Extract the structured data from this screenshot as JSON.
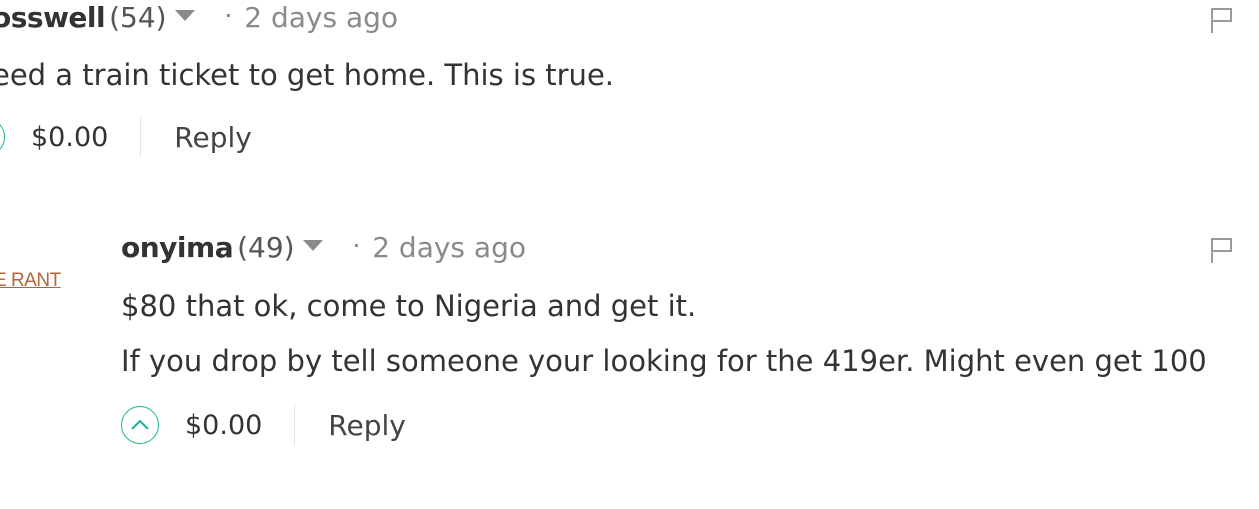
{
  "comments": [
    {
      "username": "osswell",
      "reputation": "(54)",
      "separator": "·",
      "timestamp": "2 days ago",
      "body": [
        "eed a train ticket to get home. This is true."
      ],
      "payout": "$0.00",
      "reply_label": "Reply"
    },
    {
      "avatar_label": "E RANT",
      "username": "onyima",
      "reputation": "(49)",
      "separator": "·",
      "timestamp": "2 days ago",
      "body": [
        "$80 that ok, come to Nigeria and get it.",
        "If you drop by tell someone your looking for the 419er. Might even get 100"
      ],
      "payout": "$0.00",
      "reply_label": "Reply"
    }
  ],
  "colors": {
    "upvote_accent": "#19b394",
    "avatar_text": "#b5633a",
    "timestamp": "#8a8a8a"
  },
  "icons": {
    "caret": "caret-down-icon",
    "upvote": "chevron-up-icon",
    "flag": "flag-icon"
  }
}
